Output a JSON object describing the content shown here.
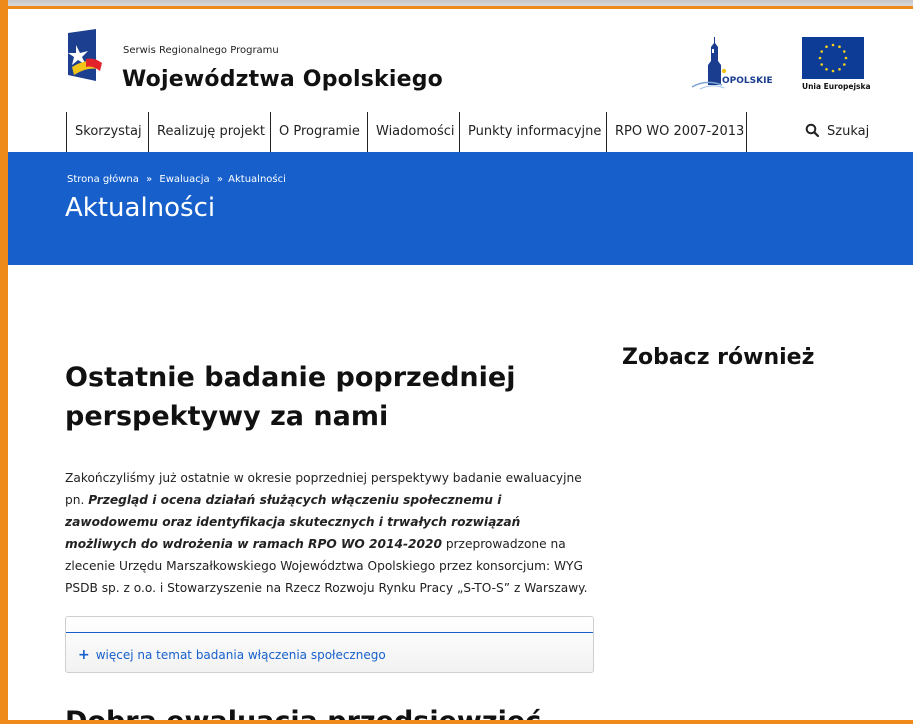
{
  "header": {
    "brand_small": "Serwis Regionalnego Programu",
    "brand_big": "Województwa Opolskiego",
    "opolskie_logo_text": "OPOLSKIE",
    "eu_label": "Unia Europejska"
  },
  "nav": {
    "items": [
      {
        "label": "Skorzystaj"
      },
      {
        "label": "Realizuję projekt"
      },
      {
        "label": "O Programie"
      },
      {
        "label": "Wiadomości"
      },
      {
        "label": "Punkty informacyjne"
      },
      {
        "label": "RPO WO 2007-2013"
      }
    ],
    "search_label": "Szukaj"
  },
  "banner": {
    "breadcrumb": [
      "Strona główna",
      "Ewaluacja",
      "Aktualności"
    ],
    "breadcrumb_sep": "»",
    "title": "Aktualności"
  },
  "article": {
    "title": "Ostatnie badanie poprzedniej perspektywy za nami",
    "body_intro": "Zakończyliśmy już ostatnie w okresie poprzedniej perspektywy badanie ewaluacyjne pn.",
    "body_bold": "Przegląd i ocena działań służących włączeniu społecznemu i zawodowemu oraz identyfikacja skutecznych i trwałych rozwiązań możliwych do wdrożenia w ramach RPO WO 2014-2020",
    "body_rest": "przeprowadzone na zlecenie Urzędu Marszałkowskiego Województwa Opolskiego przez konsorcjum: WYG PSDB sp. z o.o. i Stowarzyszenie na Rzecz Rozwoju Rynku Pracy „S-TO-S” z Warszawy.",
    "more_link": "więcej na temat badania włączenia społecznego",
    "more_plus": "+"
  },
  "sidebar": {
    "title": "Zobacz również"
  },
  "next_article": {
    "title_partial": "Dobra ewaluacja przedsięwzięć"
  },
  "colors": {
    "accent_blue": "#1760cc",
    "frame_orange": "#ee8a1a"
  }
}
